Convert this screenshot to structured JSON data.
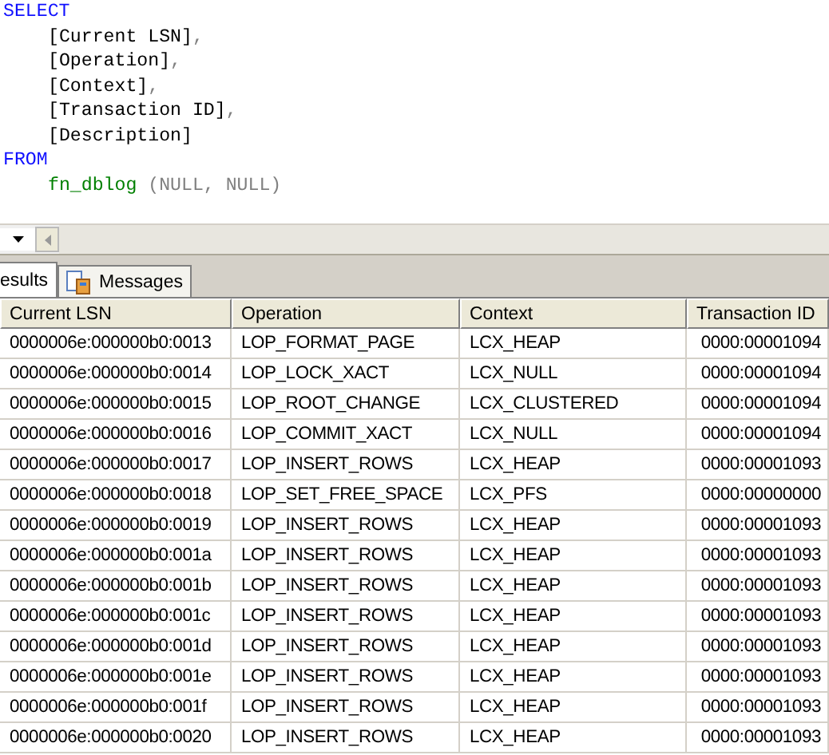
{
  "editor": {
    "lines": [
      {
        "segments": [
          {
            "kind": "keyword",
            "text": "SELECT"
          }
        ],
        "children": [
          {
            "segments": [
              {
                "kind": "identifier",
                "text": "[Current LSN]"
              },
              {
                "kind": "operator",
                "text": ","
              }
            ]
          },
          {
            "segments": [
              {
                "kind": "identifier",
                "text": "[Operation]"
              },
              {
                "kind": "operator",
                "text": ","
              }
            ]
          },
          {
            "segments": [
              {
                "kind": "identifier",
                "text": "[Context]"
              },
              {
                "kind": "operator",
                "text": ","
              }
            ]
          },
          {
            "segments": [
              {
                "kind": "identifier",
                "text": "[Transaction ID]"
              },
              {
                "kind": "operator",
                "text": ","
              }
            ]
          },
          {
            "segments": [
              {
                "kind": "identifier",
                "text": "[Description]"
              }
            ]
          }
        ]
      },
      {
        "segments": [
          {
            "kind": "keyword",
            "text": "FROM"
          }
        ],
        "children": [
          {
            "segments": [
              {
                "kind": "function",
                "text": "fn_dblog"
              },
              {
                "kind": "operator",
                "text": " (NULL, NULL)"
              }
            ]
          }
        ]
      }
    ]
  },
  "tabs": [
    {
      "label": "esults",
      "selected": true,
      "kind": "grid"
    },
    {
      "label": "Messages",
      "selected": false,
      "kind": "messages"
    }
  ],
  "table": {
    "columns": [
      "Current LSN",
      "Operation",
      "Context",
      "Transaction ID"
    ],
    "rows": [
      [
        "0000006e:000000b0:0013",
        "LOP_FORMAT_PAGE",
        "LCX_HEAP",
        "0000:00001094"
      ],
      [
        "0000006e:000000b0:0014",
        "LOP_LOCK_XACT",
        "LCX_NULL",
        "0000:00001094"
      ],
      [
        "0000006e:000000b0:0015",
        "LOP_ROOT_CHANGE",
        "LCX_CLUSTERED",
        "0000:00001094"
      ],
      [
        "0000006e:000000b0:0016",
        "LOP_COMMIT_XACT",
        "LCX_NULL",
        "0000:00001094"
      ],
      [
        "0000006e:000000b0:0017",
        "LOP_INSERT_ROWS",
        "LCX_HEAP",
        "0000:00001093"
      ],
      [
        "0000006e:000000b0:0018",
        "LOP_SET_FREE_SPACE",
        "LCX_PFS",
        "0000:00000000"
      ],
      [
        "0000006e:000000b0:0019",
        "LOP_INSERT_ROWS",
        "LCX_HEAP",
        "0000:00001093"
      ],
      [
        "0000006e:000000b0:001a",
        "LOP_INSERT_ROWS",
        "LCX_HEAP",
        "0000:00001093"
      ],
      [
        "0000006e:000000b0:001b",
        "LOP_INSERT_ROWS",
        "LCX_HEAP",
        "0000:00001093"
      ],
      [
        "0000006e:000000b0:001c",
        "LOP_INSERT_ROWS",
        "LCX_HEAP",
        "0000:00001093"
      ],
      [
        "0000006e:000000b0:001d",
        "LOP_INSERT_ROWS",
        "LCX_HEAP",
        "0000:00001093"
      ],
      [
        "0000006e:000000b0:001e",
        "LOP_INSERT_ROWS",
        "LCX_HEAP",
        "0000:00001093"
      ],
      [
        "0000006e:000000b0:001f",
        "LOP_INSERT_ROWS",
        "LCX_HEAP",
        "0000:00001093"
      ],
      [
        "0000006e:000000b0:0020",
        "LOP_INSERT_ROWS",
        "LCX_HEAP",
        "0000:00001093"
      ]
    ]
  }
}
